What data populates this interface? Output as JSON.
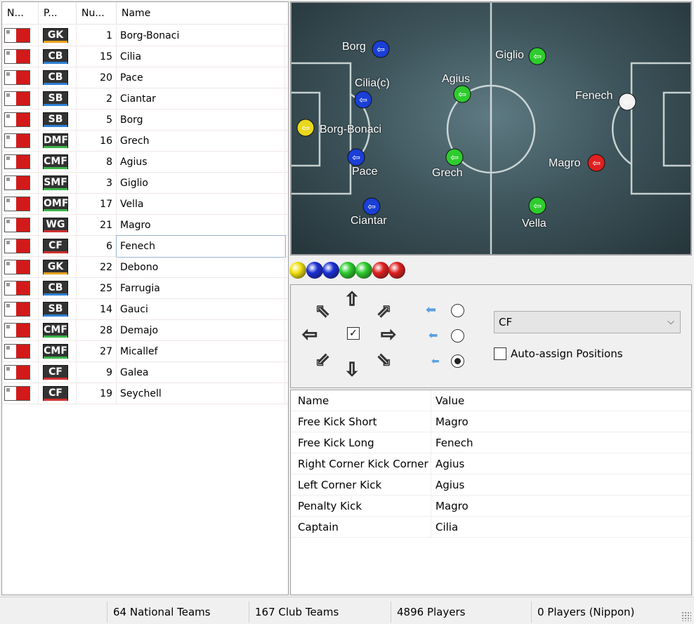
{
  "columns": {
    "flag": "N...",
    "pos": "P...",
    "num": "Nu...",
    "name": "Name"
  },
  "players": [
    {
      "pos": "GK",
      "group": "gk",
      "num": "1",
      "name": "Borg-Bonaci"
    },
    {
      "pos": "CB",
      "group": "def",
      "num": "15",
      "name": "Cilia"
    },
    {
      "pos": "CB",
      "group": "def",
      "num": "20",
      "name": "Pace"
    },
    {
      "pos": "SB",
      "group": "def",
      "num": "2",
      "name": "Ciantar"
    },
    {
      "pos": "SB",
      "group": "def",
      "num": "5",
      "name": "Borg"
    },
    {
      "pos": "DMF",
      "group": "mid",
      "num": "16",
      "name": "Grech"
    },
    {
      "pos": "CMF",
      "group": "mid",
      "num": "8",
      "name": "Agius"
    },
    {
      "pos": "SMF",
      "group": "mid",
      "num": "3",
      "name": "Giglio"
    },
    {
      "pos": "OMF",
      "group": "mid",
      "num": "17",
      "name": "Vella"
    },
    {
      "pos": "WG",
      "group": "att",
      "num": "21",
      "name": "Magro"
    },
    {
      "pos": "CF",
      "group": "att",
      "num": "6",
      "name": "Fenech",
      "selected": true
    },
    {
      "pos": "GK",
      "group": "gk",
      "num": "22",
      "name": "Debono"
    },
    {
      "pos": "CB",
      "group": "def",
      "num": "25",
      "name": "Farrugia"
    },
    {
      "pos": "SB",
      "group": "def",
      "num": "14",
      "name": "Gauci"
    },
    {
      "pos": "CMF",
      "group": "mid",
      "num": "28",
      "name": "Demajo"
    },
    {
      "pos": "CMF",
      "group": "mid",
      "num": "27",
      "name": "Micallef"
    },
    {
      "pos": "CF",
      "group": "att",
      "num": "9",
      "name": "Galea"
    },
    {
      "pos": "CF",
      "group": "att",
      "num": "19",
      "name": "Seychell"
    }
  ],
  "pitch_players": [
    {
      "name": "Borg",
      "color": "#1a3fd6"
    },
    {
      "name": "Giglio",
      "color": "#2ecc2e"
    },
    {
      "name": "Cilia(c)",
      "color": "#1a3fd6"
    },
    {
      "name": "Agius",
      "color": "#2ecc2e"
    },
    {
      "name": "Fenech",
      "color": "#f2f2f2"
    },
    {
      "name": "Borg-Bonaci",
      "color": "#e8d81e"
    },
    {
      "name": "Pace",
      "color": "#1a3fd6"
    },
    {
      "name": "Grech",
      "color": "#2ecc2e"
    },
    {
      "name": "Magro",
      "color": "#e02020"
    },
    {
      "name": "Ciantar",
      "color": "#1a3fd6"
    },
    {
      "name": "Vella",
      "color": "#2ecc2e"
    }
  ],
  "color_balls": [
    "#f0e010",
    "#1a2fd6",
    "#1a2fd6",
    "#2ecc2e",
    "#2ecc2e",
    "#e02020",
    "#e02020"
  ],
  "controls": {
    "position_value": "CF",
    "auto_assign_label": "Auto-assign Positions",
    "speed_selected": 2
  },
  "properties": {
    "header_name": "Name",
    "header_value": "Value",
    "rows": [
      {
        "k": "Free Kick Short",
        "v": "Magro"
      },
      {
        "k": "Free Kick Long",
        "v": "Fenech"
      },
      {
        "k": "Right Corner Kick Corner",
        "v": "Agius"
      },
      {
        "k": "Left Corner Kick",
        "v": "Agius"
      },
      {
        "k": "Penalty Kick",
        "v": "Magro"
      },
      {
        "k": "Captain",
        "v": "Cilia"
      }
    ]
  },
  "status": {
    "national": "64 National Teams",
    "club": "167 Club Teams",
    "players": "4896 Players",
    "nippon": "0 Players (Nippon)"
  }
}
